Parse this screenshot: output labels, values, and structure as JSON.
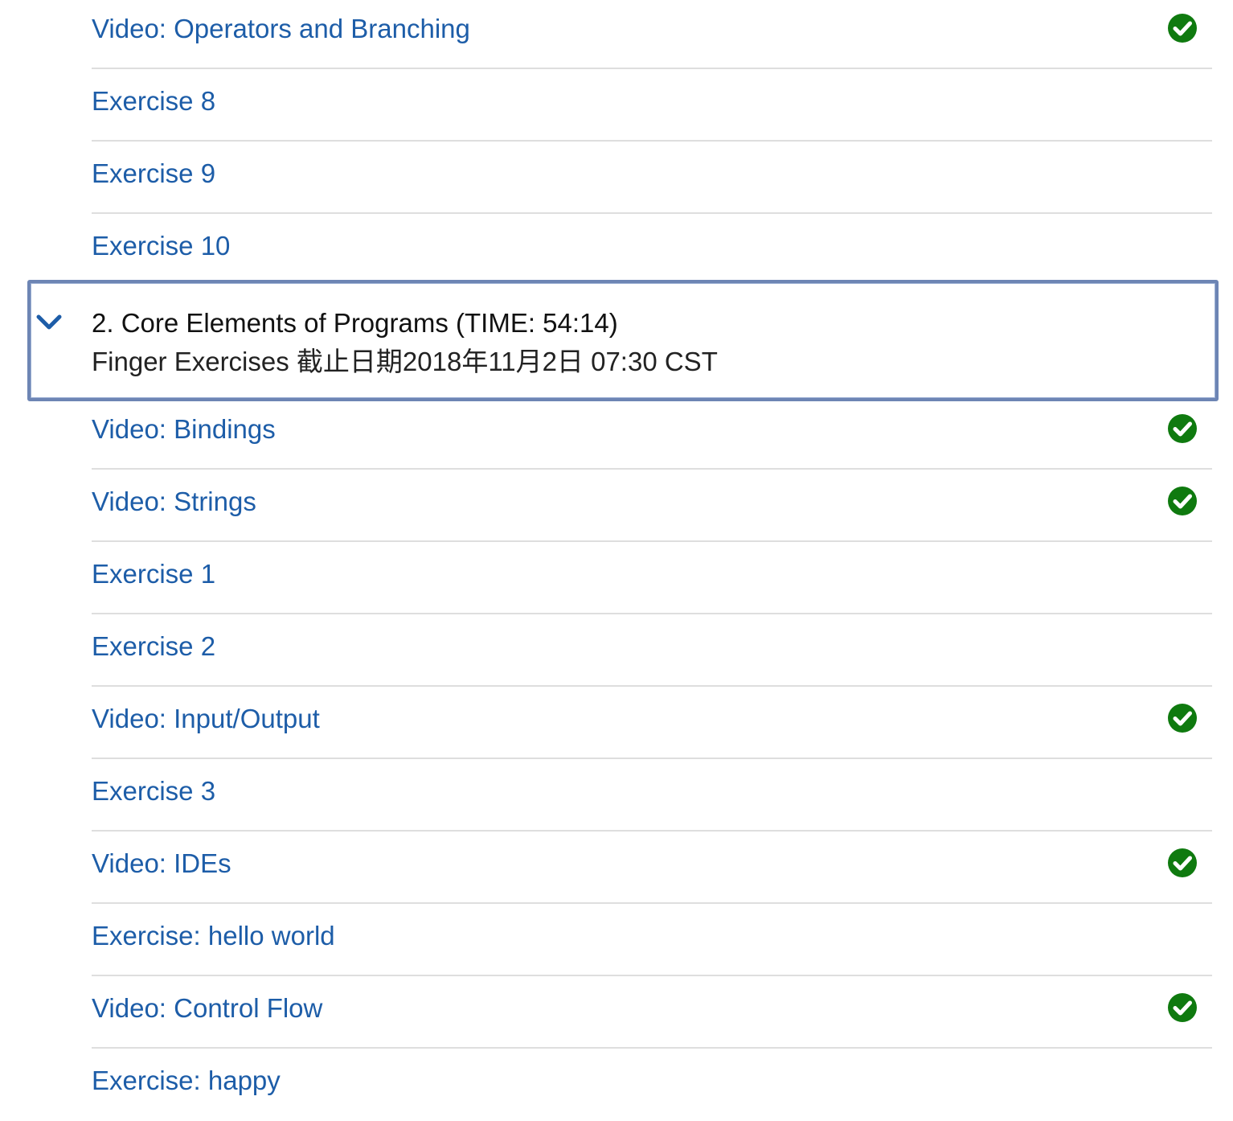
{
  "colors": {
    "link": "#1d5da8",
    "check": "#0f7a0f",
    "divider": "#dedede",
    "focus_border": "#6d85b4"
  },
  "items_before": [
    {
      "label": "Video: Operators and Branching",
      "completed": true,
      "icon": "check-circle-icon"
    },
    {
      "label": "Exercise 8",
      "completed": false
    },
    {
      "label": "Exercise 9",
      "completed": false
    },
    {
      "label": "Exercise 10",
      "completed": false
    }
  ],
  "section": {
    "title": "2. Core Elements of Programs (TIME: 54:14)",
    "subtitle": "Finger Exercises 截止日期2018年11月2日 07:30 CST",
    "expanded": true,
    "icon": "chevron-down-icon"
  },
  "items_after": [
    {
      "label": "Video: Bindings",
      "completed": true,
      "icon": "check-circle-icon"
    },
    {
      "label": "Video: Strings",
      "completed": true,
      "icon": "check-circle-icon"
    },
    {
      "label": "Exercise 1",
      "completed": false
    },
    {
      "label": "Exercise 2",
      "completed": false
    },
    {
      "label": "Video: Input/Output",
      "completed": true,
      "icon": "check-circle-icon"
    },
    {
      "label": "Exercise 3",
      "completed": false
    },
    {
      "label": "Video: IDEs",
      "completed": true,
      "icon": "check-circle-icon"
    },
    {
      "label": "Exercise: hello world",
      "completed": false
    },
    {
      "label": "Video: Control Flow",
      "completed": true,
      "icon": "check-circle-icon"
    },
    {
      "label": "Exercise: happy",
      "completed": false
    }
  ]
}
